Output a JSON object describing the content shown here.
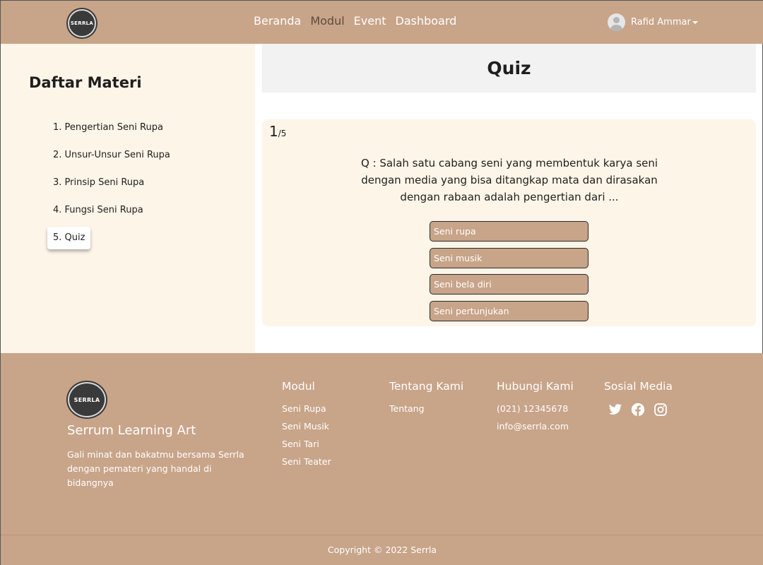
{
  "navbar": {
    "logo_text": "SERRLA",
    "links": [
      "Beranda",
      "Modul",
      "Event",
      "Dashboard"
    ],
    "active_link": "Modul",
    "user_name": "Rafid Ammar"
  },
  "sidebar": {
    "title": "Daftar Materi",
    "items": [
      "1. Pengertian Seni Rupa",
      "2. Unsur-Unsur Seni Rupa",
      "3. Prinsip Seni Rupa",
      "4. Fungsi Seni Rupa",
      "5. Quiz"
    ],
    "active_item": "5. Quiz"
  },
  "quiz": {
    "title": "Quiz",
    "current": "1",
    "total": "/5",
    "question": "Q : Salah satu cabang seni yang membentuk karya seni dengan media yang bisa ditangkap mata dan dirasakan dengan rabaan adalah pengertian dari ...",
    "options": [
      "Seni rupa",
      "Seni musik",
      "Seni bela diri",
      "Seni pertunjukan"
    ]
  },
  "footer": {
    "logo_text": "SERRLA",
    "brand_name": "Serrum Learning Art",
    "brand_desc": "Gali minat dan bakatmu bersama Serrla dengan pemateri yang handal di bidangnya",
    "modul": {
      "heading": "Modul",
      "links": [
        "Seni Rupa",
        "Seni Musik",
        "Seni Tari",
        "Seni Teater"
      ]
    },
    "tentang": {
      "heading": "Tentang Kami",
      "links": [
        "Tentang"
      ]
    },
    "hubungi": {
      "heading": "Hubungi Kami",
      "links": [
        "(021) 12345678",
        "info@serrla.com"
      ]
    },
    "sosial": {
      "heading": "Sosial Media",
      "icons": [
        "twitter-icon",
        "facebook-icon",
        "instagram-icon"
      ]
    },
    "copyright": "Copyright © 2022 Serrla"
  },
  "colors": {
    "brand": "#c8a489",
    "cream": "#fdf5e8",
    "header_gray": "#f2f2f2",
    "active_nav": "#5d4c40"
  }
}
